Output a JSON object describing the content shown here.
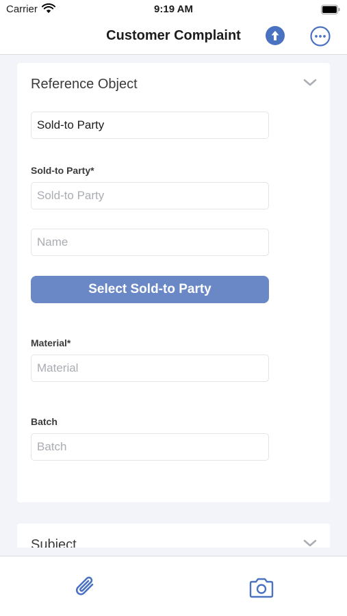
{
  "status_bar": {
    "carrier": "Carrier",
    "time": "9:19 AM"
  },
  "nav": {
    "title": "Customer Complaint",
    "upload_icon": "arrow-up-circle-icon",
    "more_icon": "ellipsis-circle-icon"
  },
  "reference_section": {
    "title": "Reference Object",
    "object_type_value": "Sold-to Party",
    "sold_to_label": "Sold-to Party*",
    "sold_to_placeholder": "Sold-to Party",
    "name_placeholder": "Name",
    "select_button_label": "Select Sold-to Party",
    "material_label": "Material*",
    "material_placeholder": "Material",
    "batch_label": "Batch",
    "batch_placeholder": "Batch"
  },
  "subject_section": {
    "title": "Subject"
  },
  "toolbar": {
    "attach_icon": "paperclip-icon",
    "camera_icon": "camera-icon"
  },
  "colors": {
    "accent": "#4a72c0",
    "button": "#6a88c6",
    "background": "#f2f4f9"
  }
}
